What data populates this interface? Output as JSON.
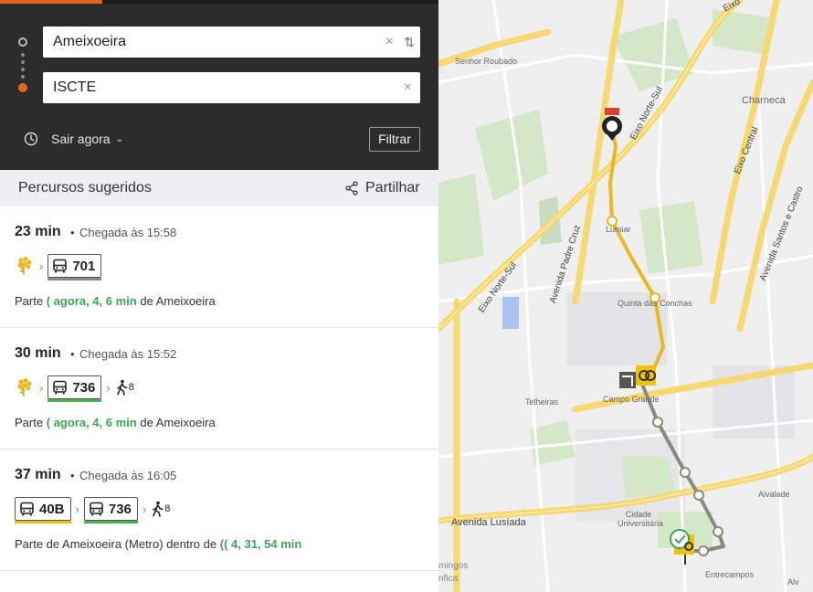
{
  "search": {
    "origin_value": "Ameixoeira",
    "dest_value": "ISCTE",
    "clear_glyph": "×",
    "swap_glyph": "⇅",
    "time_label": "Sair agora",
    "time_chevron": "⌄",
    "filter_label": "Filtrar"
  },
  "results_header": {
    "title": "Percursos sugeridos",
    "share_label": "Partilhar"
  },
  "routes": [
    {
      "duration": "23 min",
      "separator": "•",
      "arrival": "Chegada às 15:58",
      "legs": [
        {
          "type": "metro-icon"
        },
        {
          "type": "bus",
          "number": "701",
          "line_color": "#8a8a8a"
        }
      ],
      "depart_prefix": "Parte",
      "realtime": "agora, 4, 6 min",
      "depart_suffix": "de Ameixoeira"
    },
    {
      "duration": "30 min",
      "separator": "•",
      "arrival": "Chegada às 15:52",
      "legs": [
        {
          "type": "metro-icon"
        },
        {
          "type": "bus",
          "number": "736",
          "line_color": "#4caf50"
        },
        {
          "type": "walk",
          "minutes": "8"
        }
      ],
      "depart_prefix": "Parte",
      "realtime": "agora, 4, 6 min",
      "depart_suffix": "de Ameixoeira"
    },
    {
      "duration": "37 min",
      "separator": "•",
      "arrival": "Chegada às 16:05",
      "legs": [
        {
          "type": "bus",
          "number": "40B",
          "line_color": "#f2c200"
        },
        {
          "type": "bus",
          "number": "736",
          "line_color": "#4caf50"
        },
        {
          "type": "walk",
          "minutes": "8"
        }
      ],
      "depart_prefix": "Parte de Ameixoeira (Metro) dentro de",
      "realtime": "4, 31, 54 min",
      "depart_suffix": ""
    }
  ],
  "map": {
    "labels": {
      "senhor_roubado": "Senhor Roubado",
      "charneca": "Charneca",
      "lumiar": "Lumiar",
      "quinta_conchas": "Quinta das Conchas",
      "telheiras": "Telheiras",
      "campo_grande": "Campo Grande",
      "alvalade": "Alvalade",
      "cidade_universitaria": "Cidade Universitária",
      "entrecampos": "Entrecampos",
      "avenida_lusiada": "Avenida Lusíada",
      "eixo_norte_sul_top": "Eixo Norte-Sul",
      "eixo_norte_sul_left": "Eixo Norte-Sul",
      "avenida_padre_cruz": "Avenida Padre Cruz",
      "eixo_central": "Eixo Central",
      "avenida_santos_castro": "Avenida Santos e Castro",
      "eixo_top": "Eixo",
      "benfica": "nfica",
      "domingos": "mingos",
      "alv": "Alv"
    },
    "colors": {
      "route_primary": "#e8b923",
      "route_secondary": "#8a8a7a",
      "highway": "#f7dc7a",
      "park": "#cfe6c4",
      "accent": "#e2661e",
      "realtime_green": "#3ea55a"
    }
  }
}
